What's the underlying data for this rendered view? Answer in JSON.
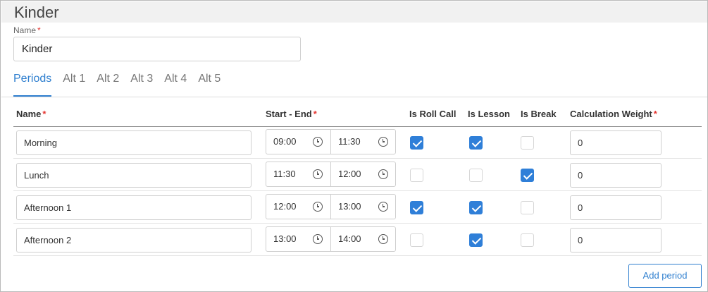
{
  "title": "Kinder",
  "form": {
    "name_label": "Name",
    "required_mark": "*",
    "name_value": "Kinder"
  },
  "tabs": [
    {
      "label": "Periods",
      "active": true
    },
    {
      "label": "Alt 1",
      "active": false
    },
    {
      "label": "Alt 2",
      "active": false
    },
    {
      "label": "Alt 3",
      "active": false
    },
    {
      "label": "Alt 4",
      "active": false
    },
    {
      "label": "Alt 5",
      "active": false
    }
  ],
  "table": {
    "headers": {
      "name": "Name",
      "start_end": "Start - End",
      "is_roll_call": "Is Roll Call",
      "is_lesson": "Is Lesson",
      "is_break": "Is Break",
      "calc_weight": "Calculation Weight"
    },
    "rows": [
      {
        "name": "Morning",
        "start": "09:00",
        "end": "11:30",
        "roll_call": true,
        "lesson": true,
        "break": false,
        "weight": "0"
      },
      {
        "name": "Lunch",
        "start": "11:30",
        "end": "12:00",
        "roll_call": false,
        "lesson": false,
        "break": true,
        "weight": "0"
      },
      {
        "name": "Afternoon 1",
        "start": "12:00",
        "end": "13:00",
        "roll_call": true,
        "lesson": true,
        "break": false,
        "weight": "0"
      },
      {
        "name": "Afternoon 2",
        "start": "13:00",
        "end": "14:00",
        "roll_call": false,
        "lesson": true,
        "break": false,
        "weight": "0"
      }
    ]
  },
  "add_period_label": "Add period",
  "colors": {
    "accent": "#2f7fcf",
    "checkbox_checked": "#2f7fd8",
    "required": "#e53935",
    "header_band": "#f1f1f1"
  },
  "icons": {
    "time": "clock-icon",
    "check": "checkmark-icon"
  }
}
